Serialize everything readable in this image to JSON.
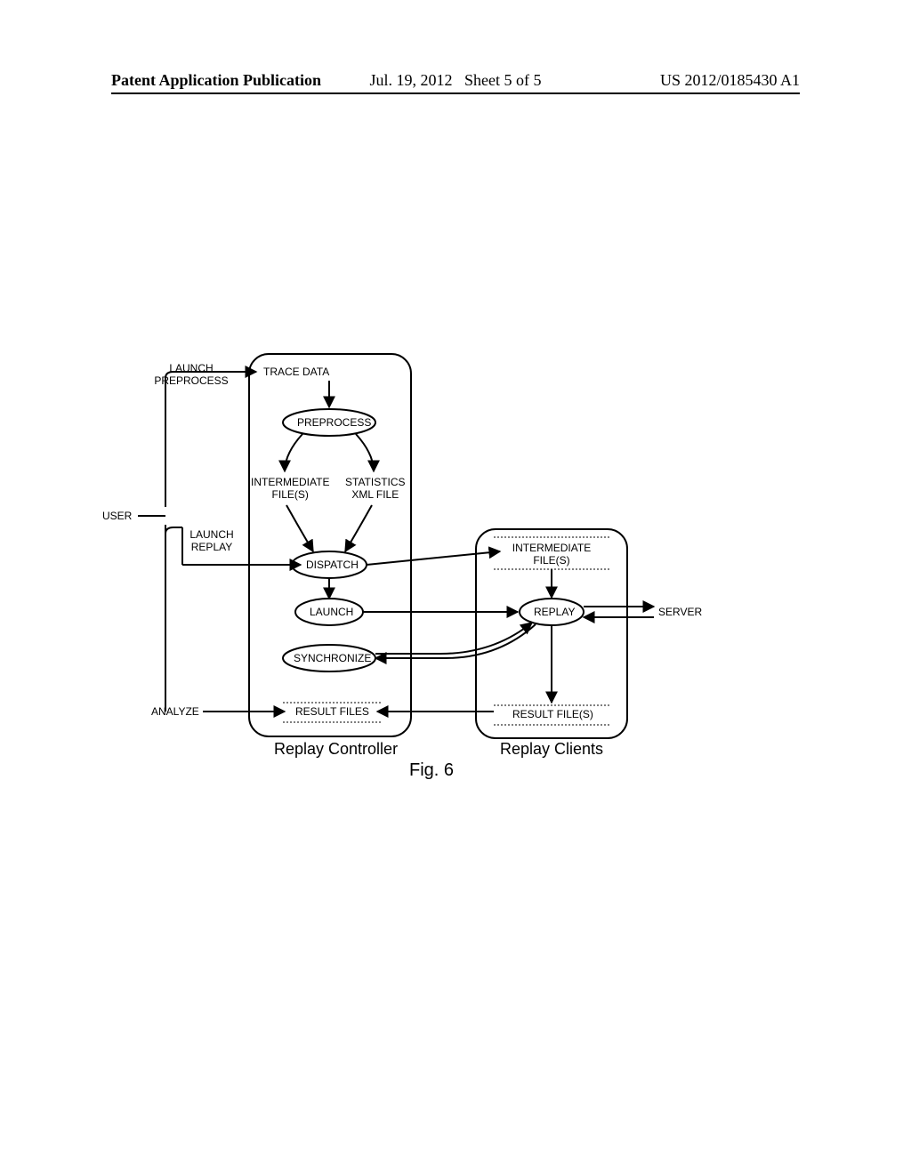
{
  "header": {
    "publication": "Patent Application Publication",
    "date": "Jul. 19, 2012",
    "sheet": "Sheet 5 of 5",
    "docno": "US 2012/0185430 A1"
  },
  "actors": {
    "user": "USER",
    "server": "SERVER"
  },
  "user_actions": {
    "launch_preprocess": "LAUNCH\nPREPROCESS",
    "launch_replay": "LAUNCH\nREPLAY",
    "analyze": "ANALYZE"
  },
  "controller": {
    "title": "Replay Controller",
    "trace_data": "TRACE DATA",
    "preprocess": "PREPROCESS",
    "intermediate_files": "INTERMEDIATE\nFILE(S)",
    "stats_xml": "STATISTICS\nXML FILE",
    "dispatch": "DISPATCH",
    "launch": "LAUNCH",
    "synchronize": "SYNCHRONIZE",
    "result_files": "RESULT FILES"
  },
  "clients": {
    "title": "Replay Clients",
    "intermediate_files": "INTERMEDIATE\nFILE(S)",
    "replay": "REPLAY",
    "result_files": "RESULT FILE(S)"
  },
  "figure": "Fig. 6"
}
